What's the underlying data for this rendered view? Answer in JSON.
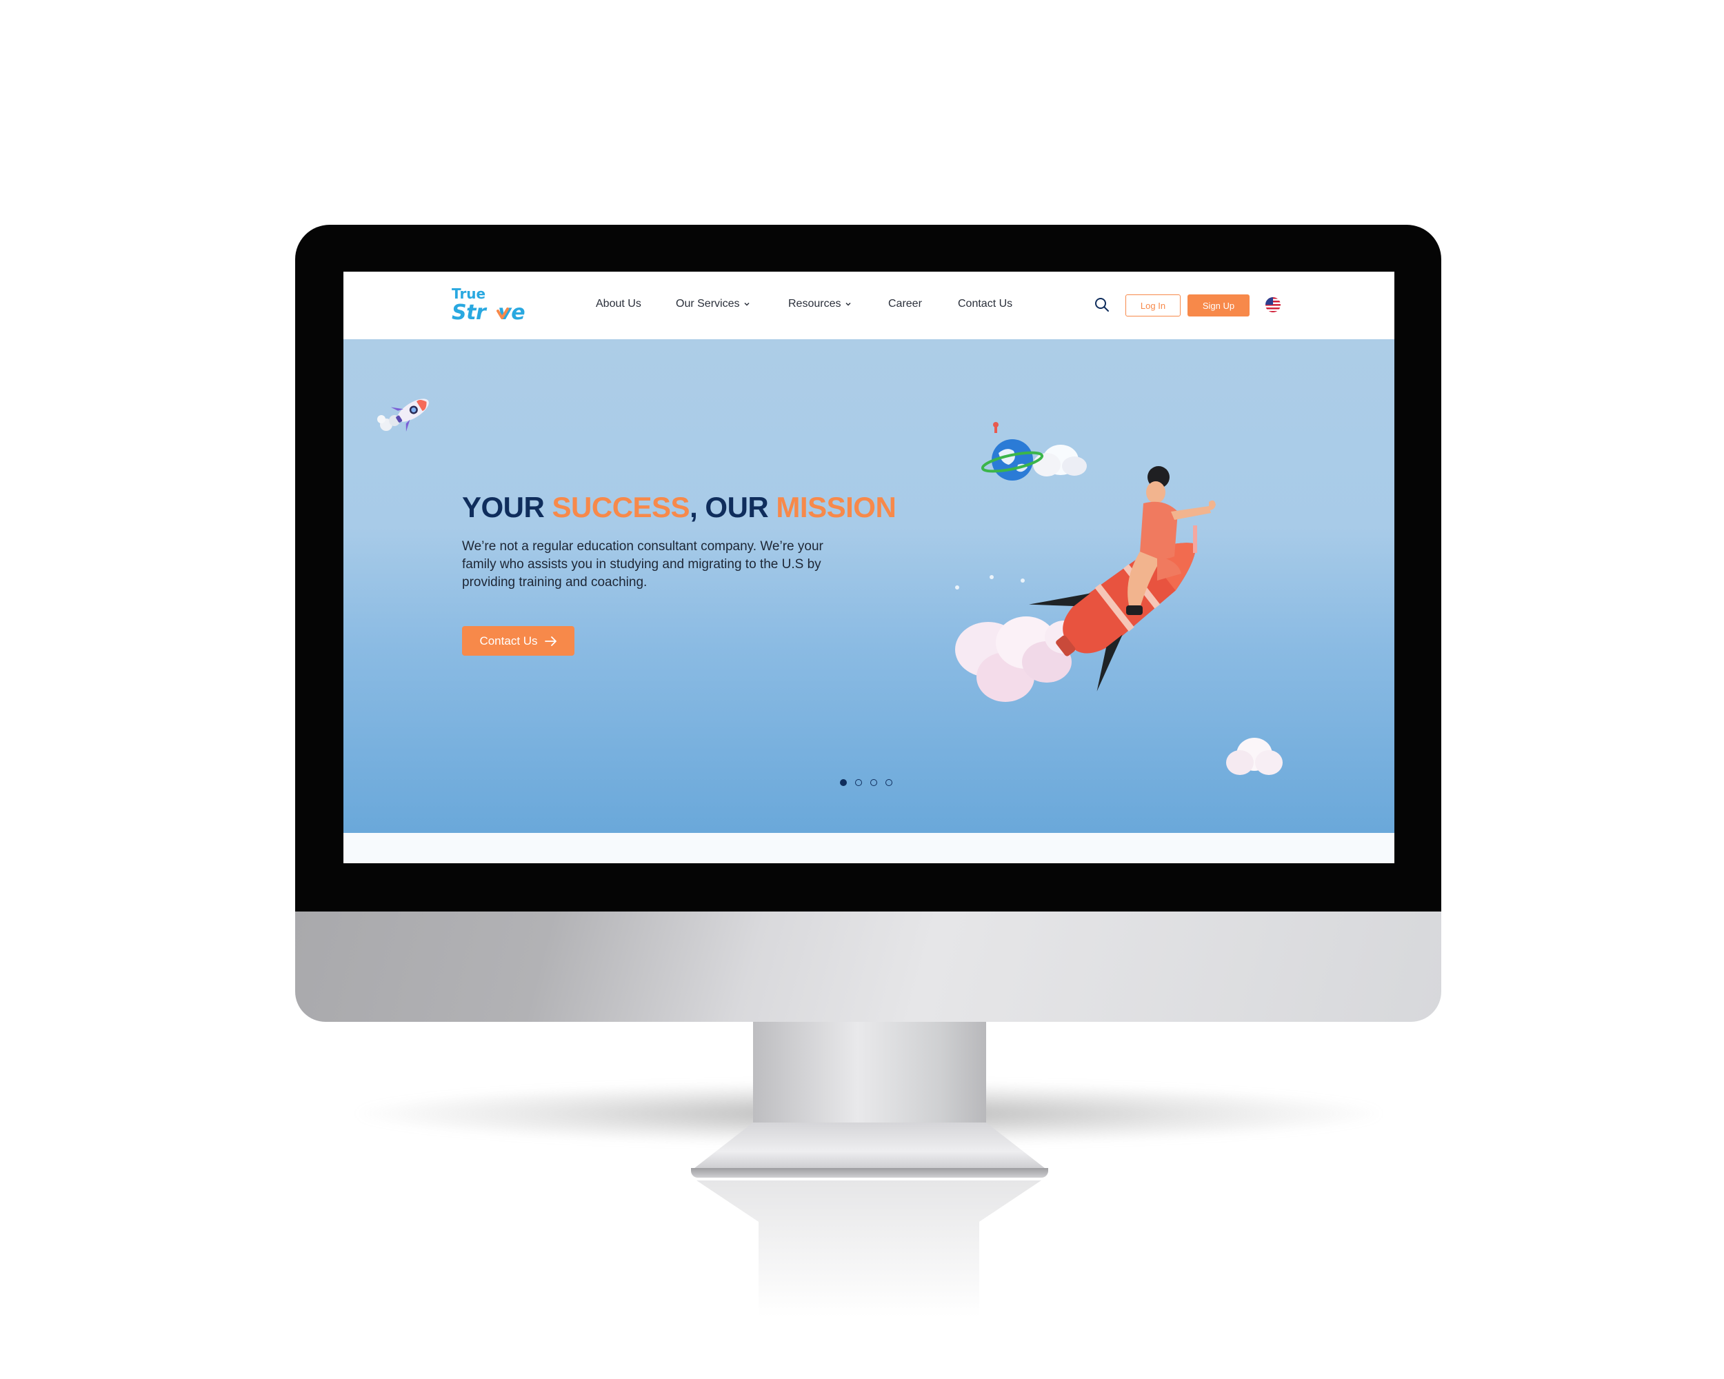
{
  "logo": {
    "line1": "True",
    "line2": "Str",
    "line3": "ve"
  },
  "nav": {
    "items": [
      {
        "label": "About Us"
      },
      {
        "label": "Our Services"
      },
      {
        "label": "Resources"
      },
      {
        "label": "Career"
      },
      {
        "label": "Contact Us"
      }
    ],
    "login_label": "Log In",
    "signup_label": "Sign Up",
    "language_flag": "us-flag-icon"
  },
  "hero": {
    "title_part1": "YOUR ",
    "title_part2": "SUCCESS",
    "title_part3": ", OUR ",
    "title_part4": "MISSION",
    "description": "We’re not a regular education consultant company. We’re your family who assists you in studying and migrating to the U.S by providing training and coaching.",
    "cta_label": "Contact Us",
    "slide_count": 4,
    "active_slide": 1
  },
  "colors": {
    "accent": "#f7894a",
    "brand": "#29a8e0",
    "title": "#0f2d5c"
  }
}
